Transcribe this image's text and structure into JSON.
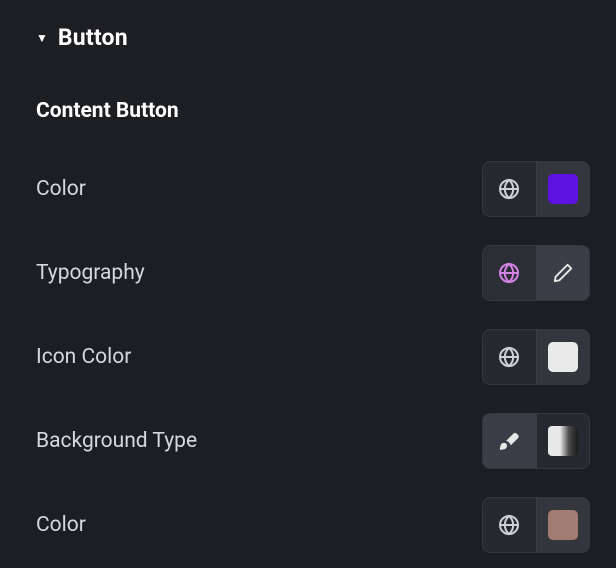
{
  "section": {
    "title": "Button",
    "expanded": true
  },
  "subtitle": "Content Button",
  "rows": [
    {
      "label": "Color",
      "left_icon": "globe",
      "left_active": false,
      "right": "swatch",
      "swatch_color": "purple"
    },
    {
      "label": "Typography",
      "left_icon": "globe",
      "left_active": true,
      "right": "pencil",
      "swatch_color": ""
    },
    {
      "label": "Icon Color",
      "left_icon": "globe",
      "left_active": false,
      "right": "swatch",
      "swatch_color": "white"
    },
    {
      "label": "Background Type",
      "left_icon": "brush",
      "left_active": false,
      "right": "gradient",
      "swatch_color": ""
    },
    {
      "label": "Color",
      "left_icon": "globe",
      "left_active": false,
      "right": "swatch",
      "swatch_color": "tan"
    }
  ],
  "colors": {
    "purple": "#5d12e0",
    "white": "#eaeaea",
    "tan": "#a27c73"
  }
}
